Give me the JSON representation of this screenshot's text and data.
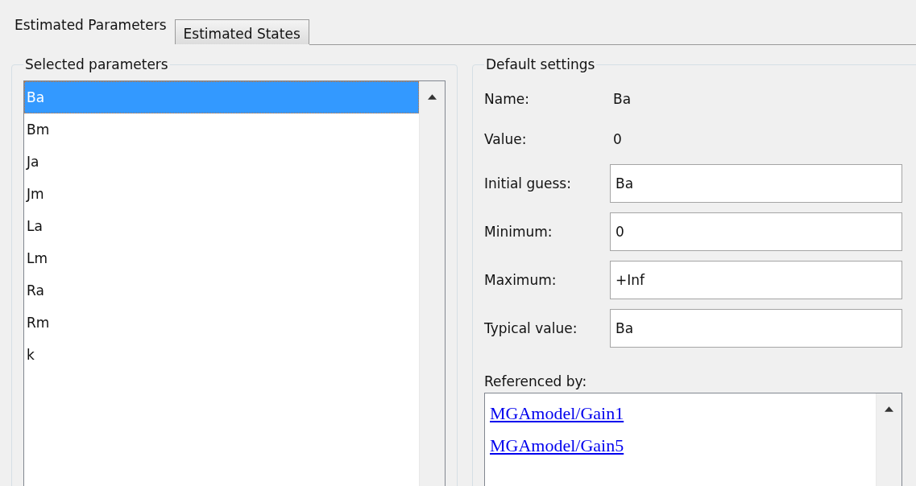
{
  "tabs": [
    {
      "label": "Estimated Parameters",
      "selected": true
    },
    {
      "label": "Estimated States",
      "selected": false
    }
  ],
  "selected_parameters": {
    "title": "Selected parameters",
    "items": [
      {
        "label": "Ba",
        "selected": true
      },
      {
        "label": "Bm",
        "selected": false
      },
      {
        "label": "Ja",
        "selected": false
      },
      {
        "label": "Jm",
        "selected": false
      },
      {
        "label": "La",
        "selected": false
      },
      {
        "label": "Lm",
        "selected": false
      },
      {
        "label": "Ra",
        "selected": false
      },
      {
        "label": "Rm",
        "selected": false
      },
      {
        "label": "k",
        "selected": false
      }
    ]
  },
  "default_settings": {
    "title": "Default settings",
    "info": [
      {
        "label": "Name:",
        "value": "Ba"
      },
      {
        "label": "Value:",
        "value": "0"
      }
    ],
    "fields": [
      {
        "label": "Initial guess:",
        "value": "Ba"
      },
      {
        "label": "Minimum:",
        "value": "0"
      },
      {
        "label": "Maximum:",
        "value": "+Inf"
      },
      {
        "label": "Typical value:",
        "value": "Ba"
      }
    ],
    "referenced_by": {
      "label": "Referenced by:",
      "links": [
        "MGAmodel/Gain1",
        "MGAmodel/Gain5"
      ]
    }
  }
}
